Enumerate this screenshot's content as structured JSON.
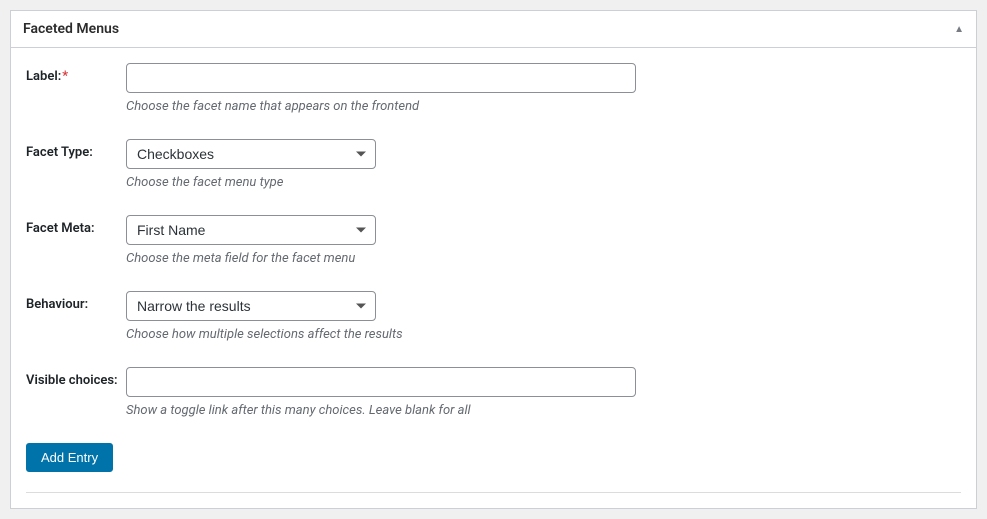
{
  "panel": {
    "title": "Faceted Menus"
  },
  "fields": {
    "label": {
      "label": "Label:",
      "value": "",
      "help": "Choose the facet name that appears on the frontend"
    },
    "facetType": {
      "label": "Facet Type:",
      "value": "Checkboxes",
      "help": "Choose the facet menu type"
    },
    "facetMeta": {
      "label": "Facet Meta:",
      "value": "First Name",
      "help": "Choose the meta field for the facet menu"
    },
    "behaviour": {
      "label": "Behaviour:",
      "value": "Narrow the results",
      "help": "Choose how multiple selections affect the results"
    },
    "visibleChoices": {
      "label": "Visible choices:",
      "value": "",
      "help": "Show a toggle link after this many choices. Leave blank for all"
    }
  },
  "buttons": {
    "addEntry": "Add Entry"
  }
}
